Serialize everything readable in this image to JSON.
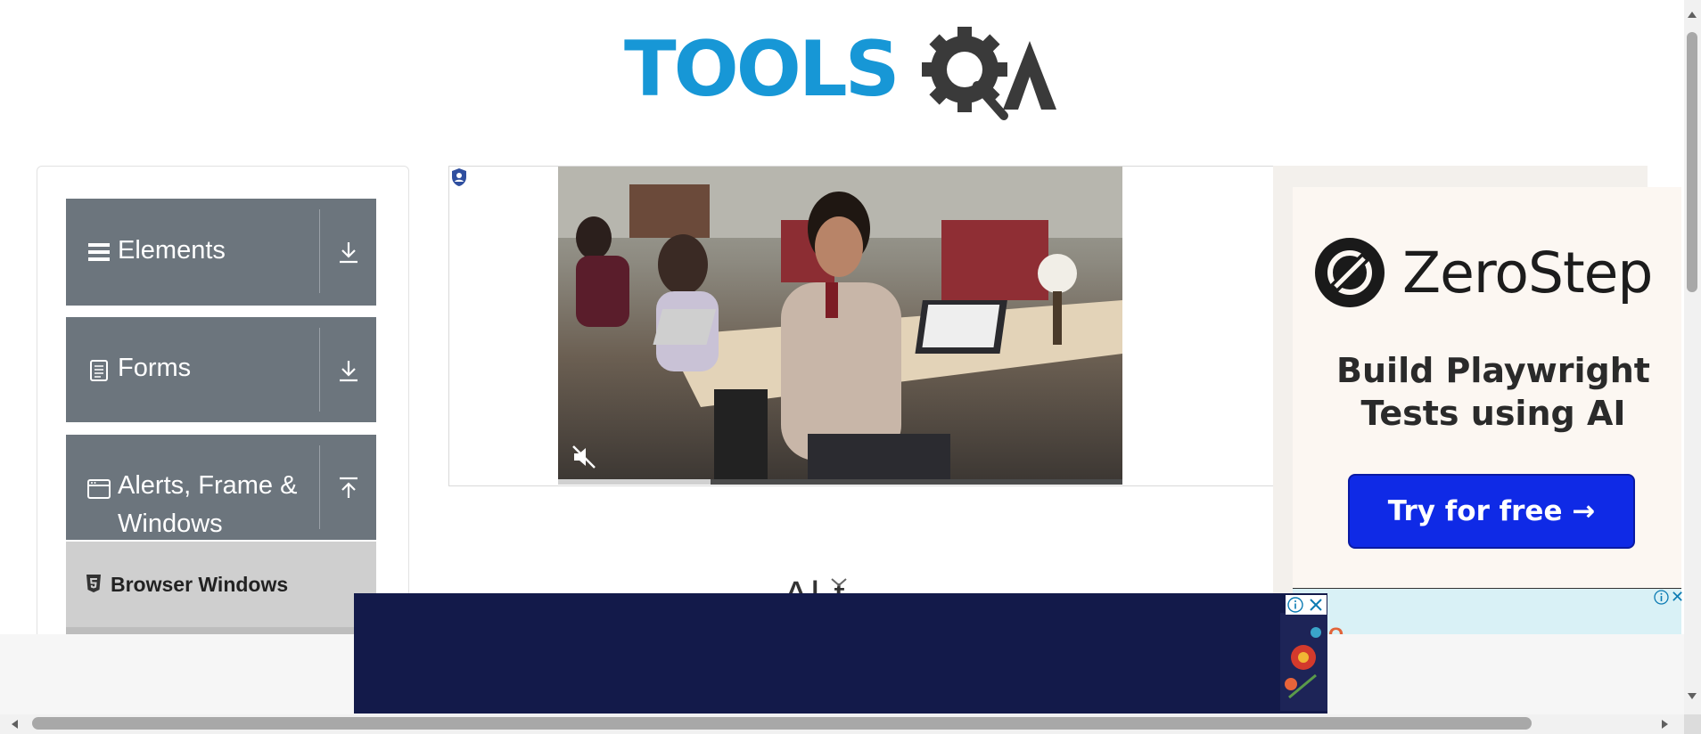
{
  "logo": {
    "text": "TOOLS",
    "qa_letter": "A",
    "alt": "TOOLSQA"
  },
  "sidebar": {
    "groups": [
      {
        "label": "Elements",
        "icon": "hamburger-icon",
        "state": "collapsed"
      },
      {
        "label": "Forms",
        "icon": "document-icon",
        "state": "collapsed"
      },
      {
        "label": "Alerts, Frame & Windows",
        "icon": "window-icon",
        "state": "expanded"
      }
    ],
    "active_item": {
      "label": "Browser Windows",
      "icon": "html5-icon"
    }
  },
  "video_ad": {
    "progress": 0.27,
    "muted": true
  },
  "right_ad": {
    "brand": "ZeroStep",
    "headline_line1": "Build Playwright",
    "headline_line2": "Tests using AI",
    "cta": "Try for free →"
  },
  "right_ad2": {
    "partial_text": "O"
  },
  "main": {
    "heading_partial": "Al   t"
  },
  "colors": {
    "accent": "#1797d6",
    "sidebar_header": "#6c757d",
    "active_item": "#cfcfcf",
    "cta": "#0f2ae6",
    "bottom_ad": "#131a4a"
  }
}
